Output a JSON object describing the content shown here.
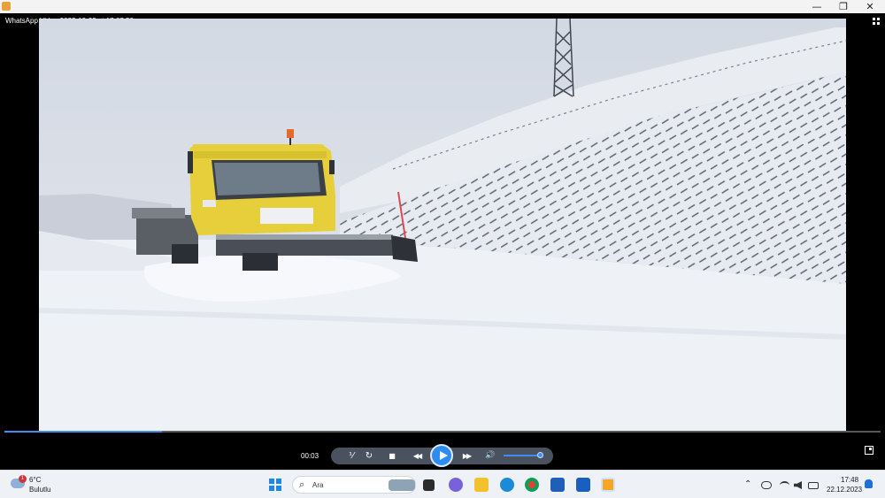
{
  "window": {
    "min_glyph": "—",
    "max_glyph": "❐",
    "close_glyph": "✕"
  },
  "player": {
    "title": "WhatsApp Video 2023-12-22 at 17.07.50",
    "current_time": "00:03",
    "progress_fraction": 0.18,
    "volume_fraction": 0.95,
    "controls": {
      "speed_glyph": "⅟",
      "repeat_glyph": "↻",
      "stop_glyph": "■",
      "rewind_glyph": "◀◀",
      "forward_glyph": "▶▶",
      "volume_glyph": "🔊"
    }
  },
  "taskbar": {
    "weather": {
      "badge": "1",
      "temperature": "6°C",
      "condition": "Bulutlu"
    },
    "search": {
      "glyph": "⌕",
      "placeholder": "Ara"
    },
    "tray": {
      "chevron": "⌃"
    },
    "clock": {
      "time": "17:48",
      "date": "22.12.2023"
    }
  },
  "colors": {
    "accent": "#2d8cf0",
    "taskbar_bg": "#eef1f6",
    "snow": "#eef1f6",
    "plow_yellow": "#e6cf3a"
  }
}
